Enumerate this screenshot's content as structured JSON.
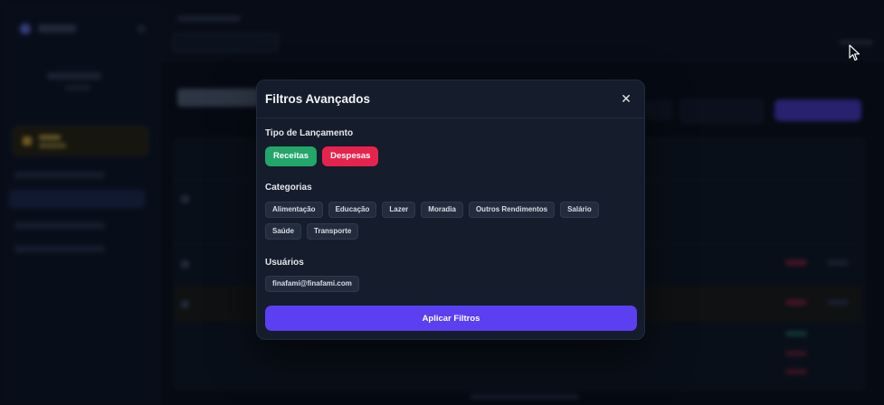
{
  "modal": {
    "title": "Filtros Avançados",
    "close_icon": "close-icon",
    "sections": {
      "type_label": "Tipo de Lançamento",
      "categories_label": "Categorias",
      "users_label": "Usuários"
    },
    "types": [
      {
        "label": "Receitas",
        "color": "#22a66a"
      },
      {
        "label": "Despesas",
        "color": "#e5244e"
      }
    ],
    "categories": [
      "Alimentação",
      "Educação",
      "Lazer",
      "Moradia",
      "Outros Rendimentos",
      "Salário",
      "Saúde",
      "Transporte"
    ],
    "users": [
      "finafami@finafami.com"
    ],
    "apply_label": "Aplicar Filtros",
    "accent_color": "#5b3ff0"
  }
}
